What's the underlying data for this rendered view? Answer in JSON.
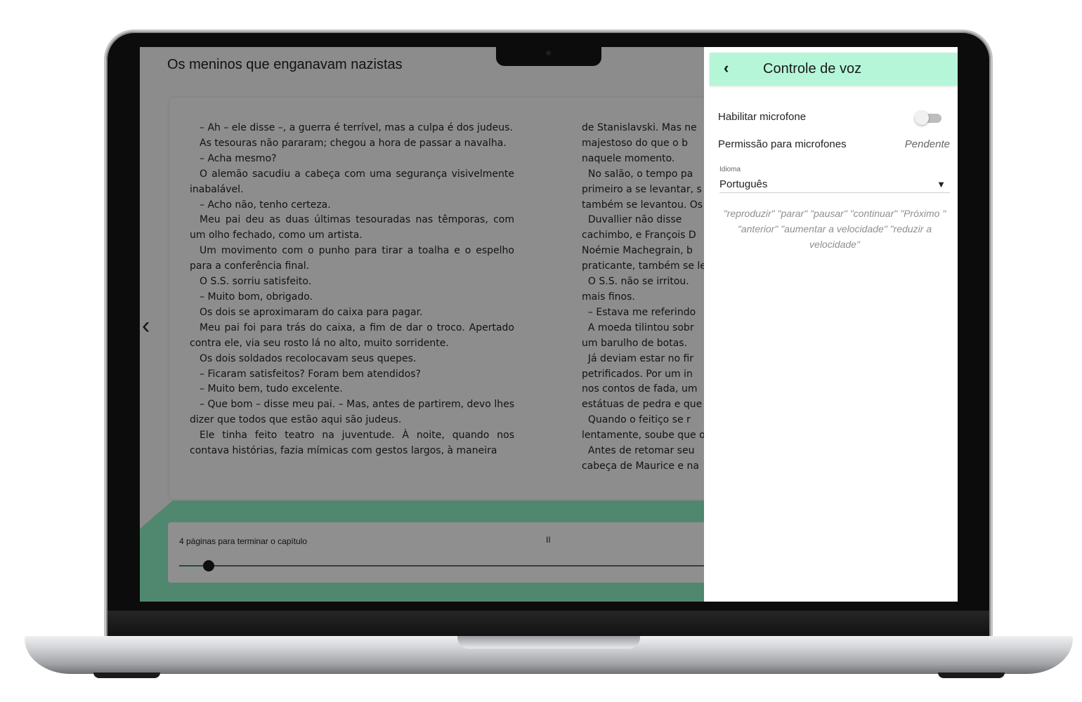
{
  "reader": {
    "book_title": "Os meninos que enganavam nazistas",
    "left_column": [
      "– Ah – ele disse –, a guerra é terrível, mas a culpa é dos judeus.",
      "As tesouras não pararam; chegou a hora de passar a navalha.",
      "– Acha mesmo?",
      "O alemão sacudiu a cabeça com uma segurança visivelmente inabalável.",
      "– Acho não, tenho certeza.",
      "Meu pai deu as duas últimas tesouradas nas têmporas, com um olho fechado, como um artista.",
      "Um movimento com o punho para tirar a toalha e o espelho para a conferência final.",
      "O S.S. sorriu satisfeito.",
      "– Muito bom, obrigado.",
      "Os dois se aproximaram do caixa para pagar.",
      "Meu pai foi para trás do caixa, a fim de dar o troco. Apertado contra ele, via seu rosto lá no alto, muito sorridente.",
      "Os dois soldados recolocavam seus quepes.",
      "– Ficaram satisfeitos? Foram bem atendidos?",
      "– Muito bem, tudo excelente.",
      "– Que bom – disse meu pai. – Mas, antes de partirem, devo lhes dizer que todos que estão aqui são judeus.",
      "Ele tinha feito teatro na juventude. À noite, quando nos contava histórias, fazia mímicas com gestos largos, à maneira"
    ],
    "right_column": [
      "de Stanislavski. Mas ne",
      "majestoso do que o b",
      "naquele momento.",
      "  No salão, o tempo pa",
      "primeiro a se levantar, s",
      "também se levantou. Os",
      "  Duvallier não disse",
      "cachimbo, e François D",
      "Noémie Machegrain, b",
      "praticante, também se le",
      "  O S.S. não se irritou.",
      "mais finos.",
      "  – Estava me referindo",
      "  A moeda tilintou sobr",
      "um barulho de botas.",
      "  Já deviam estar no fir",
      "petrificados. Por um in",
      "nos contos de fada, um",
      "estátuas de pedra e que",
      "  Quando o feitiço se r",
      "lentamente, soube que o",
      "  Antes de retomar seu",
      "cabeça de Maurice e na"
    ],
    "prev_page_glyph": "‹",
    "progress": {
      "label": "4 páginas para terminar o capítulo",
      "pause_glyph": "II",
      "fraction": 0.043
    }
  },
  "voice_panel": {
    "back_glyph": "‹",
    "title": "Controle de voz",
    "microphone_label": "Habilitar microfone",
    "microphone_enabled": false,
    "permission_label": "Permissão para microfones",
    "permission_status": "Pendente",
    "language_label": "Idioma",
    "language_value": "Português",
    "language_caret": "▼",
    "commands_text": "\"reproduzir\" \"parar\" \"pausar\" \"continuar\" \"Próximo \" \"anterior\" \"aumentar a velocidade\" \"reduzir a velocidade\""
  },
  "colors": {
    "panel_header": "#b5f6d9",
    "progress_band": "#8ef0c6",
    "overlay": "rgba(0,0,0,0.44)"
  }
}
